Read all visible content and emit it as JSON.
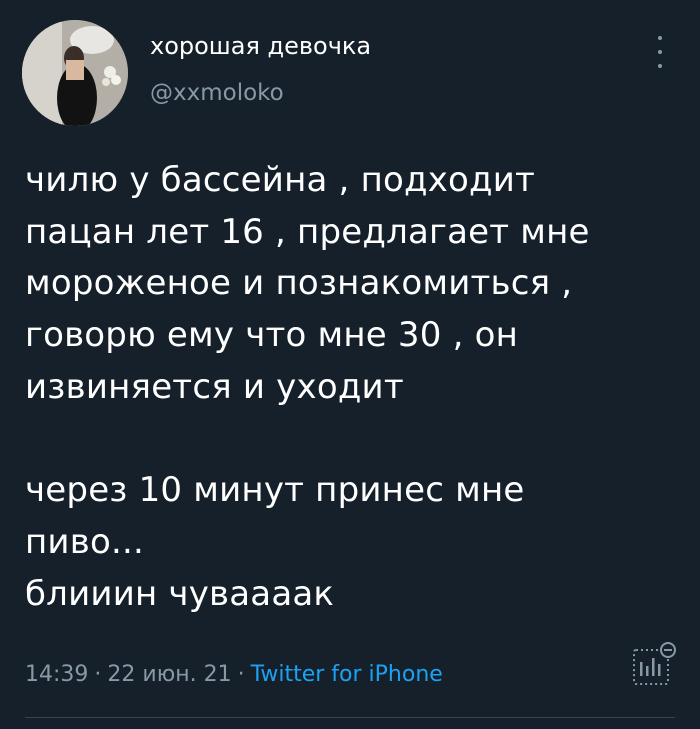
{
  "author": {
    "display_name": "хорошая девочка",
    "handle": "@xxmoloko"
  },
  "tweet": {
    "lines": [
      "чилю у бассейна , подходит",
      "пацан лет 16 , предлагает мне",
      "мороженое и познакомиться ,",
      "говорю ему что мне 30 , он",
      "извиняется и уходит",
      "",
      "через 10 минут принес мне",
      "пиво...",
      "блииин чуваааак"
    ]
  },
  "meta": {
    "time": "14:39",
    "date": "22 июн. 21",
    "separator": "·",
    "source": "Twitter for iPhone"
  },
  "icons": {
    "more": "more-vertical-icon",
    "analytics": "analytics-icon"
  },
  "colors": {
    "background": "#15202b",
    "text": "#ffffff",
    "secondary": "#8899a6",
    "link": "#1da1f2",
    "divider": "#38444d"
  }
}
